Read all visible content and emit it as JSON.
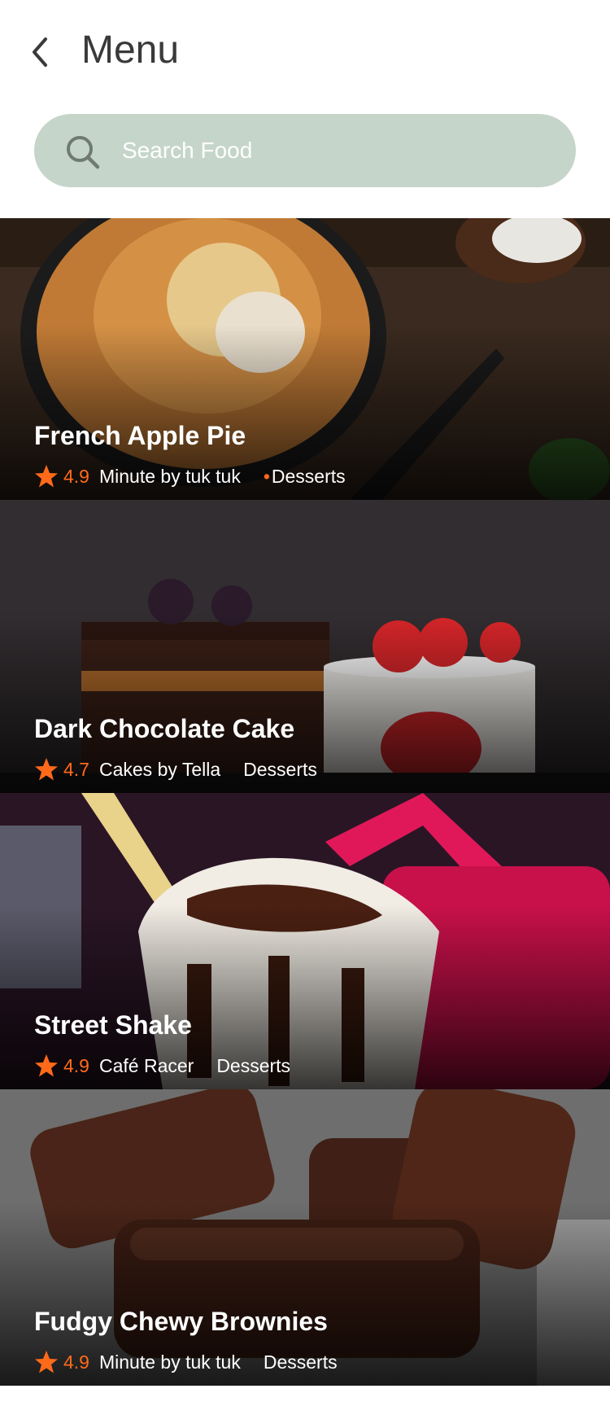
{
  "header": {
    "title": "Menu"
  },
  "search": {
    "placeholder": "Search Food"
  },
  "colors": {
    "accent": "#ff6a1a",
    "search_bg": "#c5d5ca",
    "title_text": "#3a3a3a"
  },
  "foods": [
    {
      "title": "French Apple Pie",
      "rating": "4.9",
      "restaurant": "Minute by tuk tuk",
      "category": "Desserts",
      "icon": "star-icon"
    },
    {
      "title": "Dark Chocolate Cake",
      "rating": "4.7",
      "restaurant": "Cakes by Tella",
      "category": "Desserts",
      "icon": "star-icon"
    },
    {
      "title": "Street Shake",
      "rating": "4.9",
      "restaurant": "Café Racer",
      "category": "Desserts",
      "icon": "star-icon"
    },
    {
      "title": "Fudgy Chewy Brownies",
      "rating": "4.9",
      "restaurant": "Minute by tuk tuk",
      "category": "Desserts",
      "icon": "star-icon"
    }
  ]
}
